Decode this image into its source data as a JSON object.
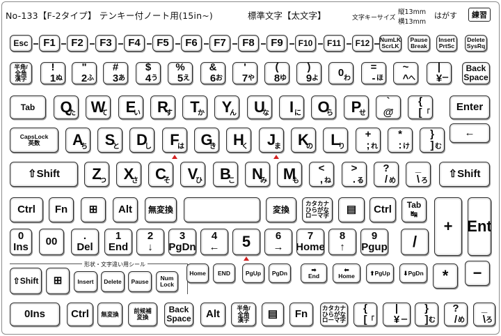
{
  "header": {
    "title": "No-133【F-2タイプ】 テンキー付ノート用(15in~)",
    "mode": "標準文字【太文字】",
    "size_label": "文字キーサイズ",
    "size_vertical": "縦13mm",
    "size_horizontal": "横13mm",
    "peel": "はがす",
    "practice": "練習"
  },
  "sticker_label": "形状・文字違い用シール",
  "keys": [
    {
      "id": "esc",
      "label": "Esc"
    },
    {
      "id": "f1",
      "label": "F1"
    },
    {
      "id": "f2",
      "label": "F2"
    },
    {
      "id": "f3",
      "label": "F3"
    },
    {
      "id": "f4",
      "label": "F4"
    },
    {
      "id": "f5",
      "label": "F5"
    },
    {
      "id": "f6",
      "label": "F6"
    },
    {
      "id": "f7",
      "label": "F7"
    },
    {
      "id": "f8",
      "label": "F8"
    },
    {
      "id": "f9",
      "label": "F9"
    },
    {
      "id": "f10",
      "label": "F10"
    },
    {
      "id": "f11",
      "label": "F11"
    },
    {
      "id": "f12",
      "label": "F12"
    },
    {
      "id": "numlk",
      "label": "NumLK\nScrLK"
    },
    {
      "id": "pause",
      "label": "Pause\nBreak"
    },
    {
      "id": "insert",
      "label": "Insert\nPrtSc"
    },
    {
      "id": "delete",
      "label": "Delete\nSysRq"
    },
    {
      "id": "hankaku",
      "label": "半角/\n全角\n漢字"
    },
    {
      "id": "k1",
      "label": "!\n1",
      "kana": "ぬ"
    },
    {
      "id": "k2",
      "label": "\"\n2",
      "kana": "ふ"
    },
    {
      "id": "k3",
      "label": "#\n3",
      "kana": "あ"
    },
    {
      "id": "k4",
      "label": "$\n4",
      "kana": "う"
    },
    {
      "id": "k5",
      "label": "%\n5",
      "kana": "え"
    },
    {
      "id": "k6",
      "label": "&\n6",
      "kana": "お"
    },
    {
      "id": "k7",
      "label": "'\n7",
      "kana": "や"
    },
    {
      "id": "k8",
      "label": "(\n8",
      "kana": "ゆ"
    },
    {
      "id": "k9",
      "label": ")\n9",
      "kana": "よ"
    },
    {
      "id": "k0",
      "label": "0",
      "kana": "わ"
    },
    {
      "id": "kminus",
      "label": "=\n-",
      "kana": "ほ"
    },
    {
      "id": "kcaret",
      "label": "~\n^",
      "kana": "へ"
    },
    {
      "id": "kyen",
      "label": "|\n¥",
      "kana": "ー"
    },
    {
      "id": "backspace",
      "label": "Back\nSpace"
    },
    {
      "id": "tab",
      "label": "Tab"
    },
    {
      "id": "q",
      "label": "Q",
      "kana": "た"
    },
    {
      "id": "w",
      "label": "W",
      "kana": "て"
    },
    {
      "id": "e",
      "label": "E",
      "kana": "い"
    },
    {
      "id": "r",
      "label": "R",
      "kana": "す"
    },
    {
      "id": "t",
      "label": "T",
      "kana": "か"
    },
    {
      "id": "y",
      "label": "Y",
      "kana": "ん"
    },
    {
      "id": "u",
      "label": "U",
      "kana": "な"
    },
    {
      "id": "i",
      "label": "I",
      "kana": "に"
    },
    {
      "id": "o",
      "label": "O",
      "kana": "ら"
    },
    {
      "id": "p",
      "label": "P",
      "kana": "せ"
    },
    {
      "id": "at",
      "label": "`\n@",
      "kana": "゛"
    },
    {
      "id": "lbrace",
      "label": "{\n[",
      "kana": "「"
    },
    {
      "id": "enter",
      "label": "Enter"
    },
    {
      "id": "capslock",
      "label": "CapsLock\n英数"
    },
    {
      "id": "a",
      "label": "A",
      "kana": "ち"
    },
    {
      "id": "s",
      "label": "S",
      "kana": "と"
    },
    {
      "id": "d",
      "label": "D",
      "kana": "し"
    },
    {
      "id": "f",
      "label": "F",
      "kana": "は"
    },
    {
      "id": "g",
      "label": "G",
      "kana": "き"
    },
    {
      "id": "h",
      "label": "H",
      "kana": "く"
    },
    {
      "id": "j",
      "label": "J",
      "kana": "ま"
    },
    {
      "id": "k",
      "label": "K",
      "kana": "の"
    },
    {
      "id": "l",
      "label": "L",
      "kana": "り"
    },
    {
      "id": "semi",
      "label": "+\n;",
      "kana": "れ"
    },
    {
      "id": "colon",
      "label": "*\n:",
      "kana": "け"
    },
    {
      "id": "rbrace",
      "label": "}\n]",
      "kana": "む"
    },
    {
      "id": "enter2",
      "label": "←"
    },
    {
      "id": "lshift",
      "label": "⇧Shift"
    },
    {
      "id": "z",
      "label": "Z",
      "kana": "つ"
    },
    {
      "id": "x",
      "label": "X",
      "kana": "さ"
    },
    {
      "id": "c",
      "label": "C",
      "kana": "そ"
    },
    {
      "id": "v",
      "label": "V",
      "kana": "ひ"
    },
    {
      "id": "b",
      "label": "B",
      "kana": "こ"
    },
    {
      "id": "n",
      "label": "N",
      "kana": "み"
    },
    {
      "id": "m",
      "label": "M",
      "kana": "も"
    },
    {
      "id": "comma",
      "label": "<\n,",
      "kana": "ね"
    },
    {
      "id": "period",
      "label": ">\n.",
      "kana": "る"
    },
    {
      "id": "slash",
      "label": "?\n/",
      "kana": "め"
    },
    {
      "id": "bslash",
      "label": "_\n\\",
      "kana": "ろ"
    },
    {
      "id": "rshift",
      "label": "⇧Shift"
    },
    {
      "id": "ctrl",
      "label": "Ctrl"
    },
    {
      "id": "fn",
      "label": "Fn"
    },
    {
      "id": "win",
      "label": "⊞"
    },
    {
      "id": "alt",
      "label": "Alt"
    },
    {
      "id": "muhenkan",
      "label": "無変換"
    },
    {
      "id": "space",
      "label": ""
    },
    {
      "id": "henkan",
      "label": "変換"
    },
    {
      "id": "katakana",
      "label": "カタカナ\nひらがな\nローマ字"
    },
    {
      "id": "menu",
      "label": "▤"
    },
    {
      "id": "rctrl",
      "label": "Ctrl"
    },
    {
      "id": "rtab",
      "label": "Tab\n↹"
    },
    {
      "id": "n0",
      "label": "0\nIns"
    },
    {
      "id": "n00",
      "label": "00"
    },
    {
      "id": "ndel",
      "label": ".\nDel"
    },
    {
      "id": "n1",
      "label": "1\nEnd"
    },
    {
      "id": "n2",
      "label": "2\n↓"
    },
    {
      "id": "n3",
      "label": "3\nPgDn"
    },
    {
      "id": "n4",
      "label": "4\n←"
    },
    {
      "id": "n5",
      "label": "5"
    },
    {
      "id": "n6",
      "label": "6\n→"
    },
    {
      "id": "n7",
      "label": "7\nHome"
    },
    {
      "id": "n8",
      "label": "8\n↑"
    },
    {
      "id": "n9",
      "label": "9\nPgup"
    },
    {
      "id": "nslash",
      "label": "/"
    },
    {
      "id": "nplus",
      "label": "+"
    },
    {
      "id": "nent",
      "label": "Ent"
    },
    {
      "id": "s_shift",
      "label": "⇧Shift"
    },
    {
      "id": "s_win",
      "label": "⊞"
    },
    {
      "id": "s_insert",
      "label": "Insert"
    },
    {
      "id": "s_delete",
      "label": "Delete"
    },
    {
      "id": "s_pause",
      "label": "Pause"
    },
    {
      "id": "s_numlock",
      "label": "Num\nLock"
    },
    {
      "id": "home",
      "label": "Home"
    },
    {
      "id": "end",
      "label": "END"
    },
    {
      "id": "pgup",
      "label": "PgUp"
    },
    {
      "id": "pgdn",
      "label": "PgDn"
    },
    {
      "id": "endarrow",
      "label": "➡\nEnd"
    },
    {
      "id": "homearrow",
      "label": "⬅\nHome"
    },
    {
      "id": "pgupa",
      "label": "⬆PgUp"
    },
    {
      "id": "pgdna",
      "label": "⬇PgDn"
    },
    {
      "id": "nstar",
      "label": "*"
    },
    {
      "id": "nminus",
      "label": "−"
    },
    {
      "id": "b_ins",
      "label": "0Ins"
    },
    {
      "id": "b_ctrl",
      "label": "Ctrl"
    },
    {
      "id": "b_muhen",
      "label": "無変換"
    },
    {
      "id": "b_zenkouho",
      "label": "前候補\n変換"
    },
    {
      "id": "b_back",
      "label": "Back\nSpace"
    },
    {
      "id": "b_alt",
      "label": "Alt"
    },
    {
      "id": "b_hankaku",
      "label": "半角/\n全角\n漢字"
    },
    {
      "id": "b_menu",
      "label": "▤"
    },
    {
      "id": "b_fn",
      "label": "Fn"
    },
    {
      "id": "b_kata",
      "label": "カタカナ\nひらがな\nローマ字"
    },
    {
      "id": "b_brace",
      "label": "{\n[",
      "kana": "「"
    },
    {
      "id": "b_yen",
      "label": "|\n¥",
      "kana": "ー"
    },
    {
      "id": "b_rbrace",
      "label": "}\n]",
      "kana": "む"
    },
    {
      "id": "b_slash",
      "label": "?\n/",
      "kana": "め"
    },
    {
      "id": "b_bslash",
      "label": "_\n\\",
      "kana": "ろ"
    }
  ]
}
